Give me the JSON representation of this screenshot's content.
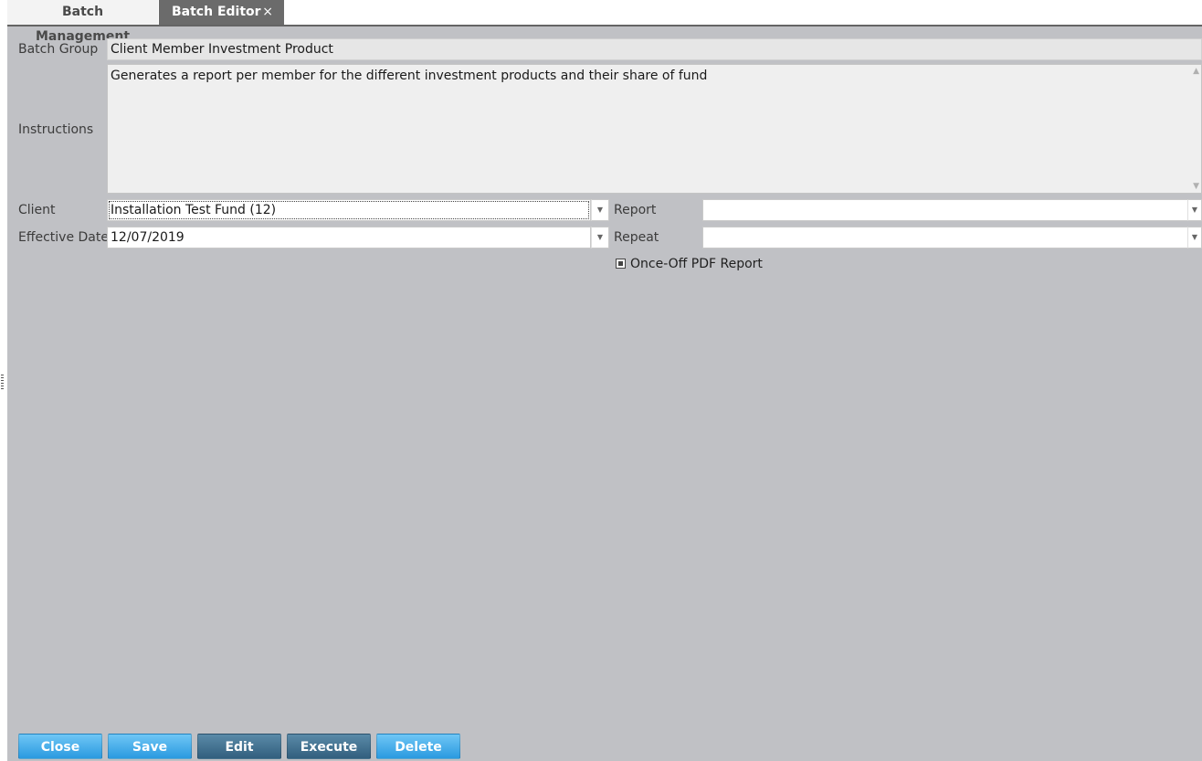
{
  "tabs": [
    {
      "label": "Batch Management",
      "active": false
    },
    {
      "label": "Batch Editor",
      "active": true,
      "close_icon": "×"
    }
  ],
  "form": {
    "batch_group": {
      "label": "Batch Group",
      "value": "Client Member Investment Product"
    },
    "instructions": {
      "label": "Instructions",
      "value": "Generates a report per member for the different investment products and their share of fund"
    },
    "client": {
      "label": "Client",
      "value": "Installation Test Fund (12)"
    },
    "effective_date": {
      "label": "Effective Date",
      "value": "12/07/2019"
    },
    "report": {
      "label": "Report",
      "value": ""
    },
    "repeat": {
      "label": "Repeat",
      "value": ""
    },
    "once_off_pdf": {
      "label": "Once-Off PDF Report",
      "checked": true
    }
  },
  "buttons": {
    "close": "Close",
    "save": "Save",
    "edit": "Edit",
    "execute": "Execute",
    "delete": "Delete"
  },
  "colors": {
    "background": "#c0c1c5",
    "active_tab": "#6b6b6b",
    "button_light": "#2a9ae0",
    "button_dark": "#325f7e"
  }
}
